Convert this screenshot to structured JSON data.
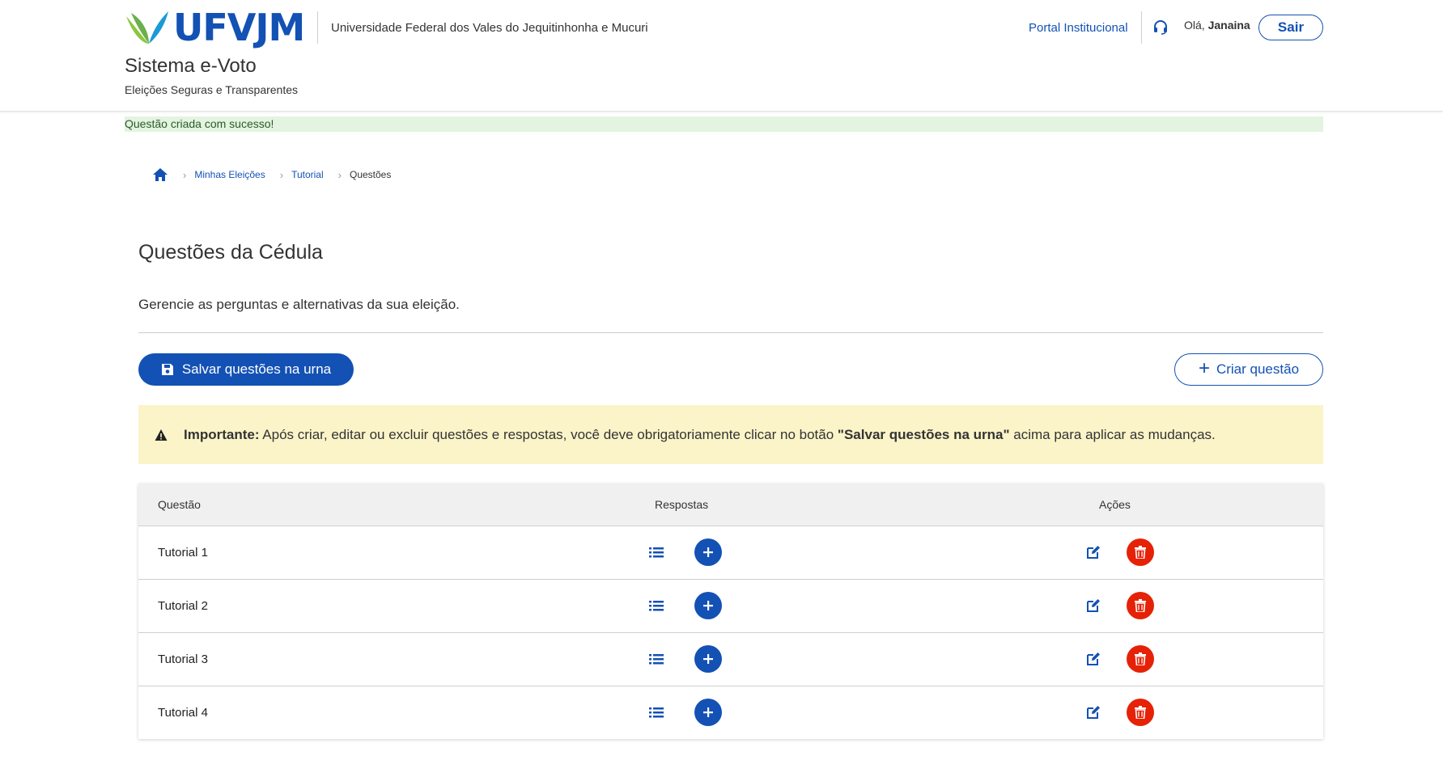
{
  "header": {
    "logo_text": "UFVJM",
    "university": "Universidade Federal dos Vales do Jequitinhonha e Mucuri",
    "system_title": "Sistema e-Voto",
    "system_subtitle": "Eleições Seguras e Transparentes",
    "portal_link": "Portal Institucional",
    "greeting_prefix": "Olá,",
    "user_name": "Janaina",
    "logout_label": "Sair"
  },
  "alert": {
    "success_message": "Questão criada com sucesso!"
  },
  "breadcrumb": {
    "items": [
      "Minhas Eleições",
      "Tutorial"
    ],
    "current": "Questões"
  },
  "page": {
    "title": "Questões da Cédula",
    "description": "Gerencie as perguntas e alternativas da sua eleição."
  },
  "actions": {
    "save_label": "Salvar questões na urna",
    "create_label": "Criar questão"
  },
  "warning": {
    "label": "Importante:",
    "text_before": " Após criar, editar ou excluir questões e respostas, você deve obrigatoriamente clicar no botão ",
    "emphasis": "\"Salvar questões na urna\"",
    "text_after": " acima para aplicar as mudanças."
  },
  "table": {
    "headers": [
      "Questão",
      "Respostas",
      "Ações"
    ],
    "rows": [
      {
        "question": "Tutorial 1"
      },
      {
        "question": "Tutorial 2"
      },
      {
        "question": "Tutorial 3"
      },
      {
        "question": "Tutorial 4"
      }
    ]
  },
  "colors": {
    "primary": "#1351b4",
    "danger": "#e52207",
    "success_bg": "#e3f4e0",
    "warning_bg": "#fbf4c8",
    "logo_green": "#8cc63f"
  },
  "icons": [
    "home-icon",
    "support-icon",
    "save-icon",
    "plus-icon",
    "warning-icon",
    "list-icon",
    "edit-icon",
    "trash-icon"
  ]
}
